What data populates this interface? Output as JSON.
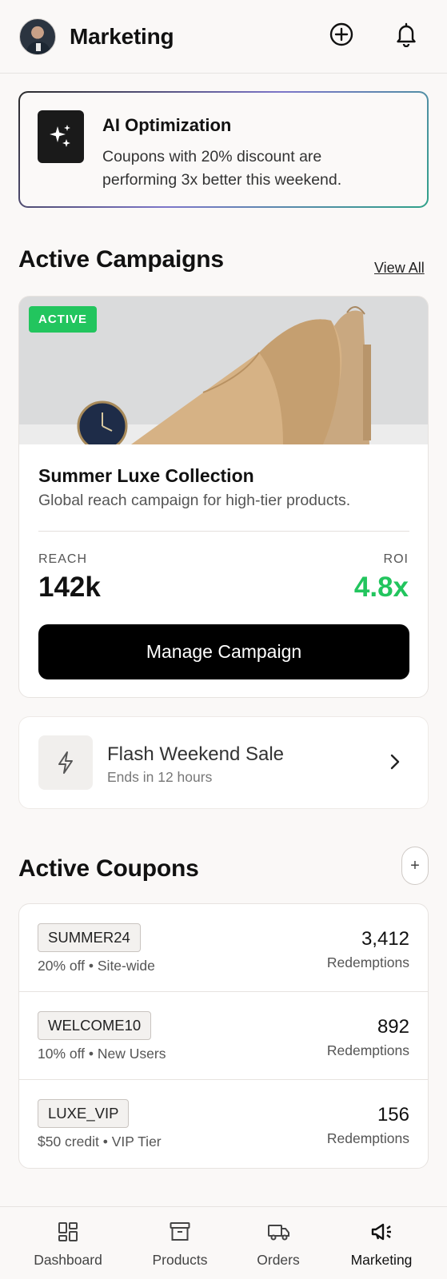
{
  "header": {
    "title": "Marketing",
    "add_icon": "plus-circle-icon",
    "notification_icon": "bell-icon"
  },
  "ai_card": {
    "title": "AI Optimization",
    "text": "Coupons with 20% discount are performing 3x better this weekend.",
    "icon": "sparkles-icon"
  },
  "campaigns": {
    "section_title": "Active Campaigns",
    "view_all": "View All",
    "featured": {
      "badge": "ACTIVE",
      "title": "Summer Luxe Collection",
      "description": "Global reach campaign for high-tier products.",
      "reach_label": "REACH",
      "reach_value": "142k",
      "roi_label": "ROI",
      "roi_value": "4.8x",
      "button": "Manage Campaign"
    },
    "secondary": {
      "title": "Flash Weekend Sale",
      "subtitle": "Ends in 12 hours",
      "icon": "bolt-icon"
    }
  },
  "coupons": {
    "section_title": "Active Coupons",
    "add_label": "+",
    "items": [
      {
        "code": "SUMMER24",
        "desc": "20% off • Site-wide",
        "count": "3,412",
        "count_label": "Redemptions"
      },
      {
        "code": "WELCOME10",
        "desc": "10% off • New Users",
        "count": "892",
        "count_label": "Redemptions"
      },
      {
        "code": "LUXE_VIP",
        "desc": "$50 credit • VIP Tier",
        "count": "156",
        "count_label": "Redemptions"
      }
    ]
  },
  "nav": {
    "items": [
      {
        "label": "Dashboard",
        "icon": "dashboard-icon"
      },
      {
        "label": "Products",
        "icon": "archive-box-icon"
      },
      {
        "label": "Orders",
        "icon": "truck-icon"
      },
      {
        "label": "Marketing",
        "icon": "megaphone-icon"
      }
    ],
    "active": "Marketing"
  },
  "colors": {
    "accent_green": "#22c55e",
    "primary_black": "#000000",
    "background": "#faf8f7"
  }
}
